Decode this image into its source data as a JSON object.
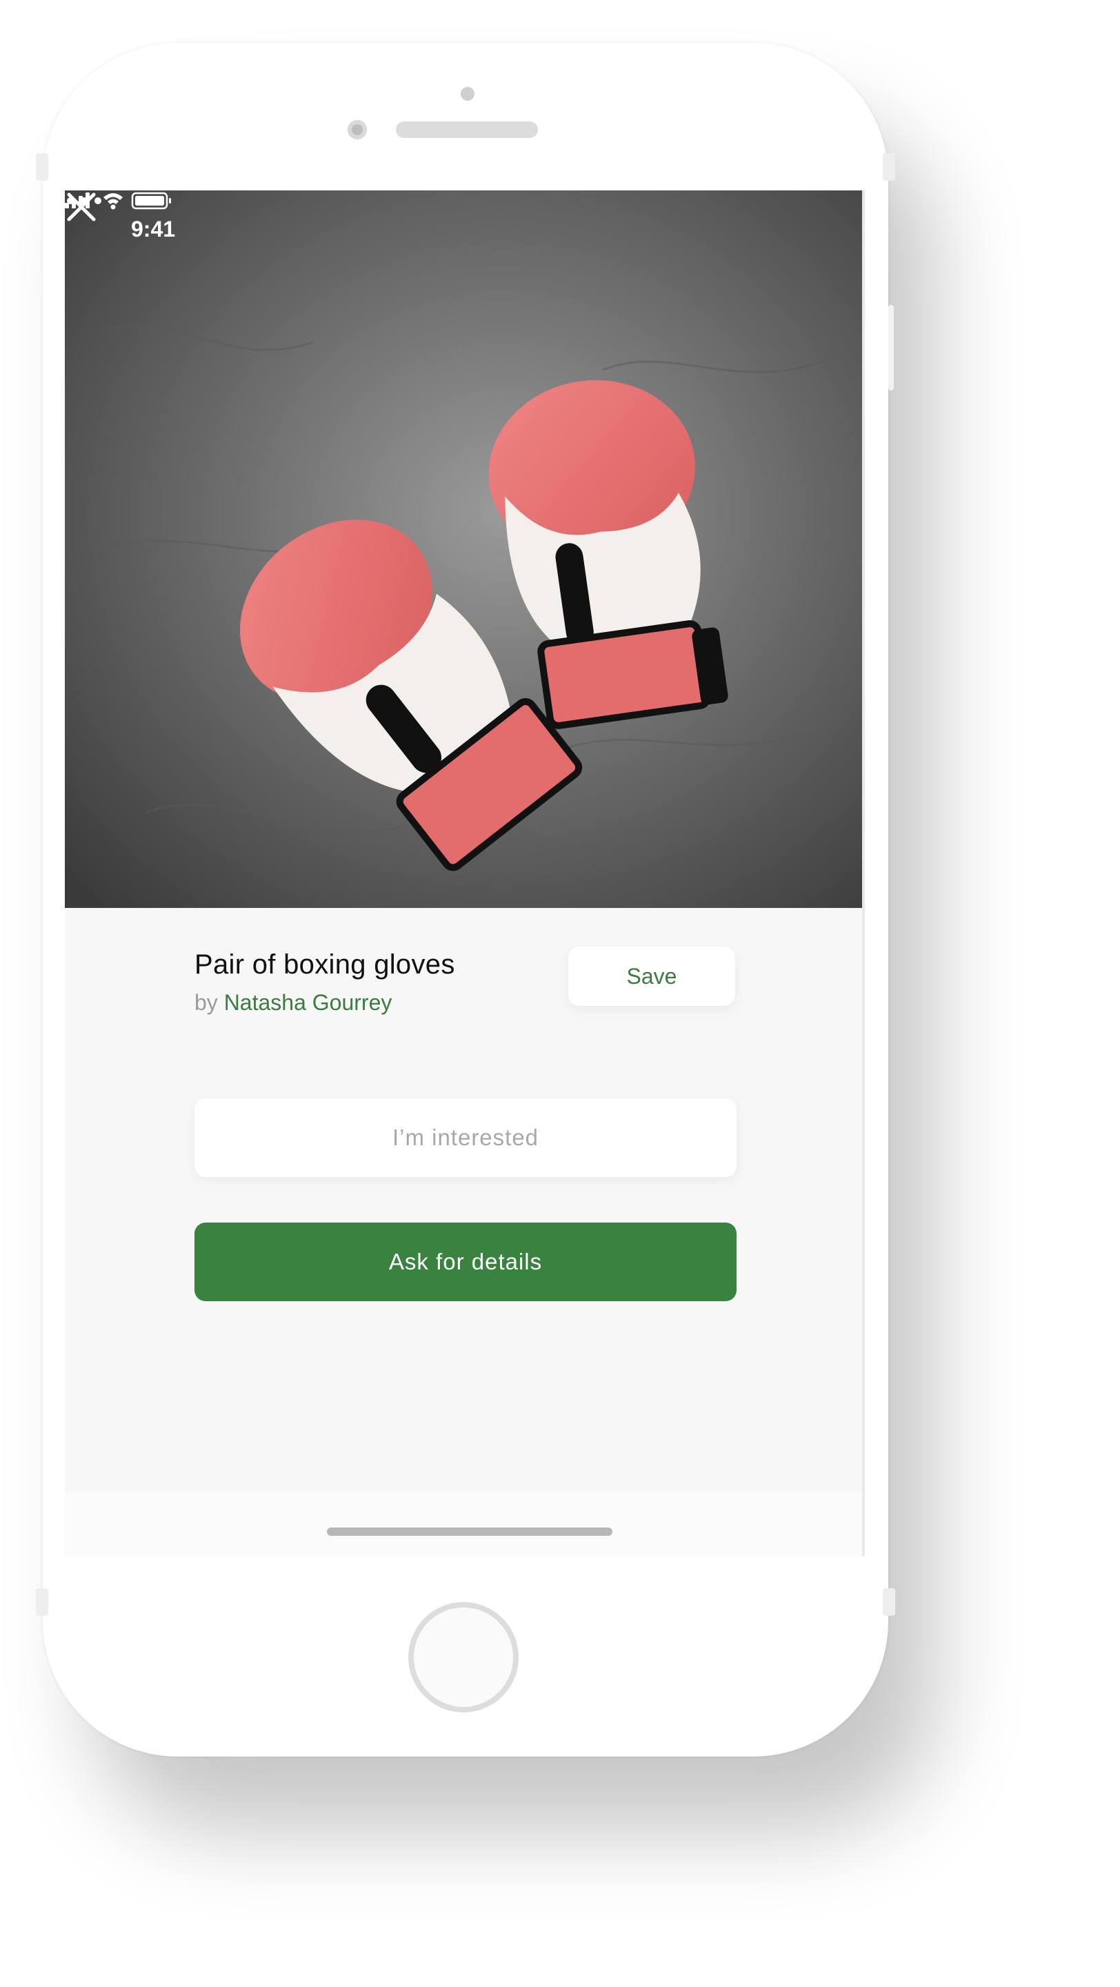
{
  "status_bar": {
    "time": "9:41"
  },
  "nav": {
    "close_icon": "close-icon",
    "more_icon": "more-dots-icon"
  },
  "hero": {
    "image_description_icon": "boxing-gloves-photo"
  },
  "listing": {
    "title": "Pair of boxing gloves",
    "by_prefix": "by",
    "author": "Natasha Gourrey",
    "save_label": "Save"
  },
  "actions": {
    "interested_label": "I’m interested",
    "ask_label": "Ask for details"
  },
  "colors": {
    "accent": "#3a8240",
    "author_text": "#3a7d3f",
    "background": "#f7f7f7"
  }
}
